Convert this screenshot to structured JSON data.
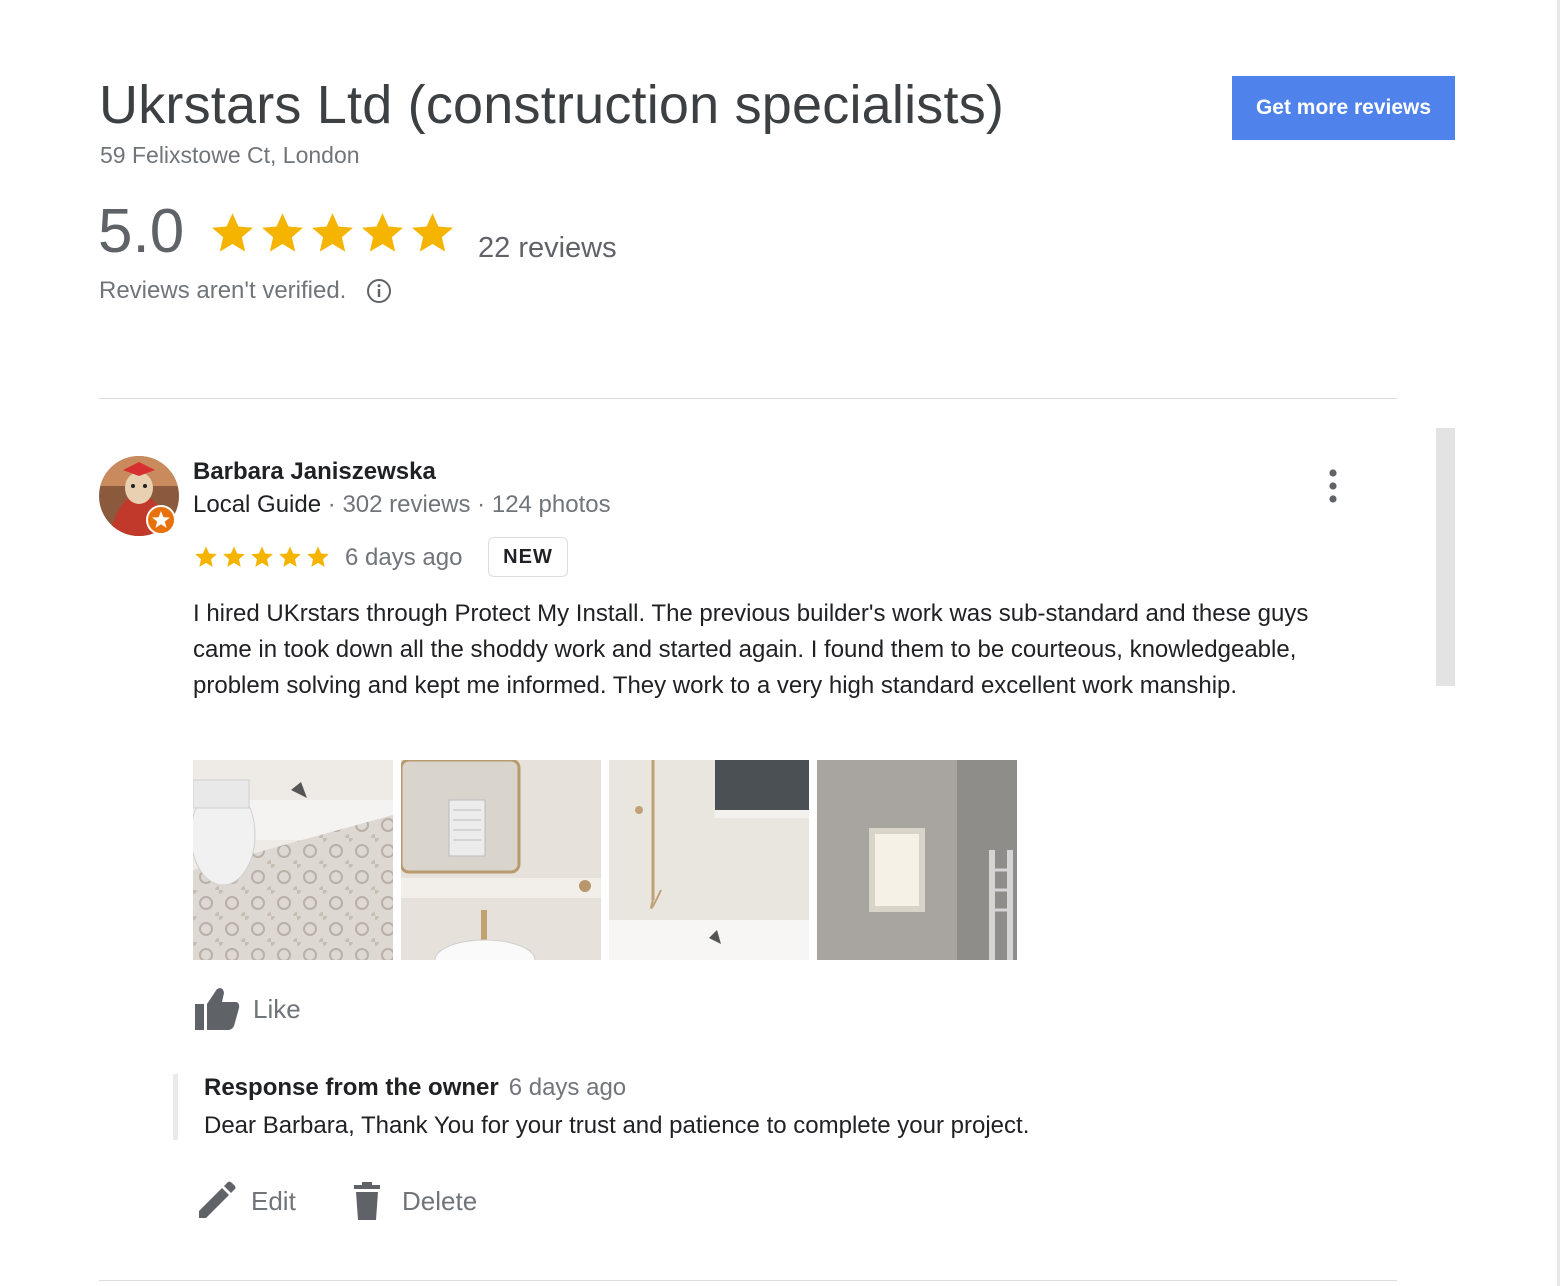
{
  "business": {
    "name": "Ukrstars Ltd (construction specialists)",
    "address": "59 Felixstowe Ct, London",
    "rating": "5.0",
    "rating_stars": 5,
    "review_count": "22 reviews",
    "verified_note": "Reviews aren't verified."
  },
  "get_more_reviews_label": "Get more reviews",
  "review": {
    "reviewer_name": "Barbara Janiszewska",
    "reviewer_badge": "Local Guide",
    "reviewer_reviews": "302 reviews",
    "reviewer_photos": "124 photos",
    "stars": 5,
    "date": "6 days ago",
    "new_badge": "NEW",
    "text": "I hired UKrstars through Protect My Install.  The previous builder's work was sub-standard and these guys came in took down all the shoddy work and started again. I found them to be courteous, knowledgeable, problem solving and kept me informed.  They work to a very high standard excellent work manship.",
    "like_label": "Like"
  },
  "response": {
    "title": "Response from the owner",
    "date": "6 days ago",
    "text": "Dear Barbara, Thank You for your trust and patience to complete your project."
  },
  "actions": {
    "edit_label": "Edit",
    "delete_label": "Delete"
  },
  "colors": {
    "star": "#f4b400",
    "button": "#4f83eb",
    "muted_text": "#70757a"
  },
  "icons": [
    "star-icon",
    "info-icon",
    "more-vert-icon",
    "thumb-up-icon",
    "edit-pencil-icon",
    "delete-trash-icon",
    "local-guide-badge-icon"
  ]
}
